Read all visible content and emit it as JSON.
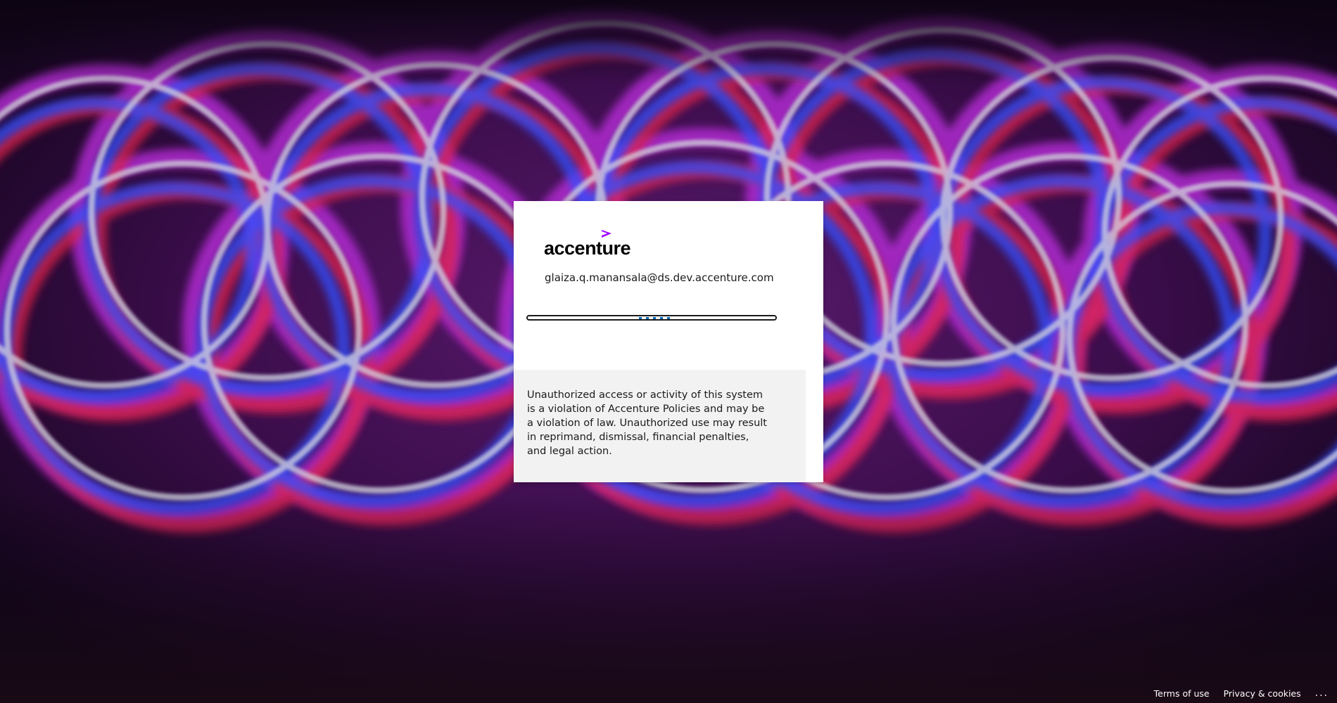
{
  "colors": {
    "background_dark": "#16061c",
    "accent_purple": "#a100ff",
    "progress_blue": "#0067b8",
    "notice_bg": "#f2f2f2"
  },
  "background": {
    "icon": "neon-light-rings-photo"
  },
  "card": {
    "logo_text": "accenture",
    "logo_mark_icon": "accenture-greater-than-icon",
    "email": "glaiza.q.manansala@ds.dev.accenture.com",
    "notice": "Unauthorized access or activity of this system is a violation of Accenture Policies and may be a violation of law. Unauthorized use may result in reprimand, dismissal, financial penalties, and legal action."
  },
  "footer": {
    "terms": "Terms of use",
    "privacy": "Privacy & cookies",
    "more": "..."
  }
}
